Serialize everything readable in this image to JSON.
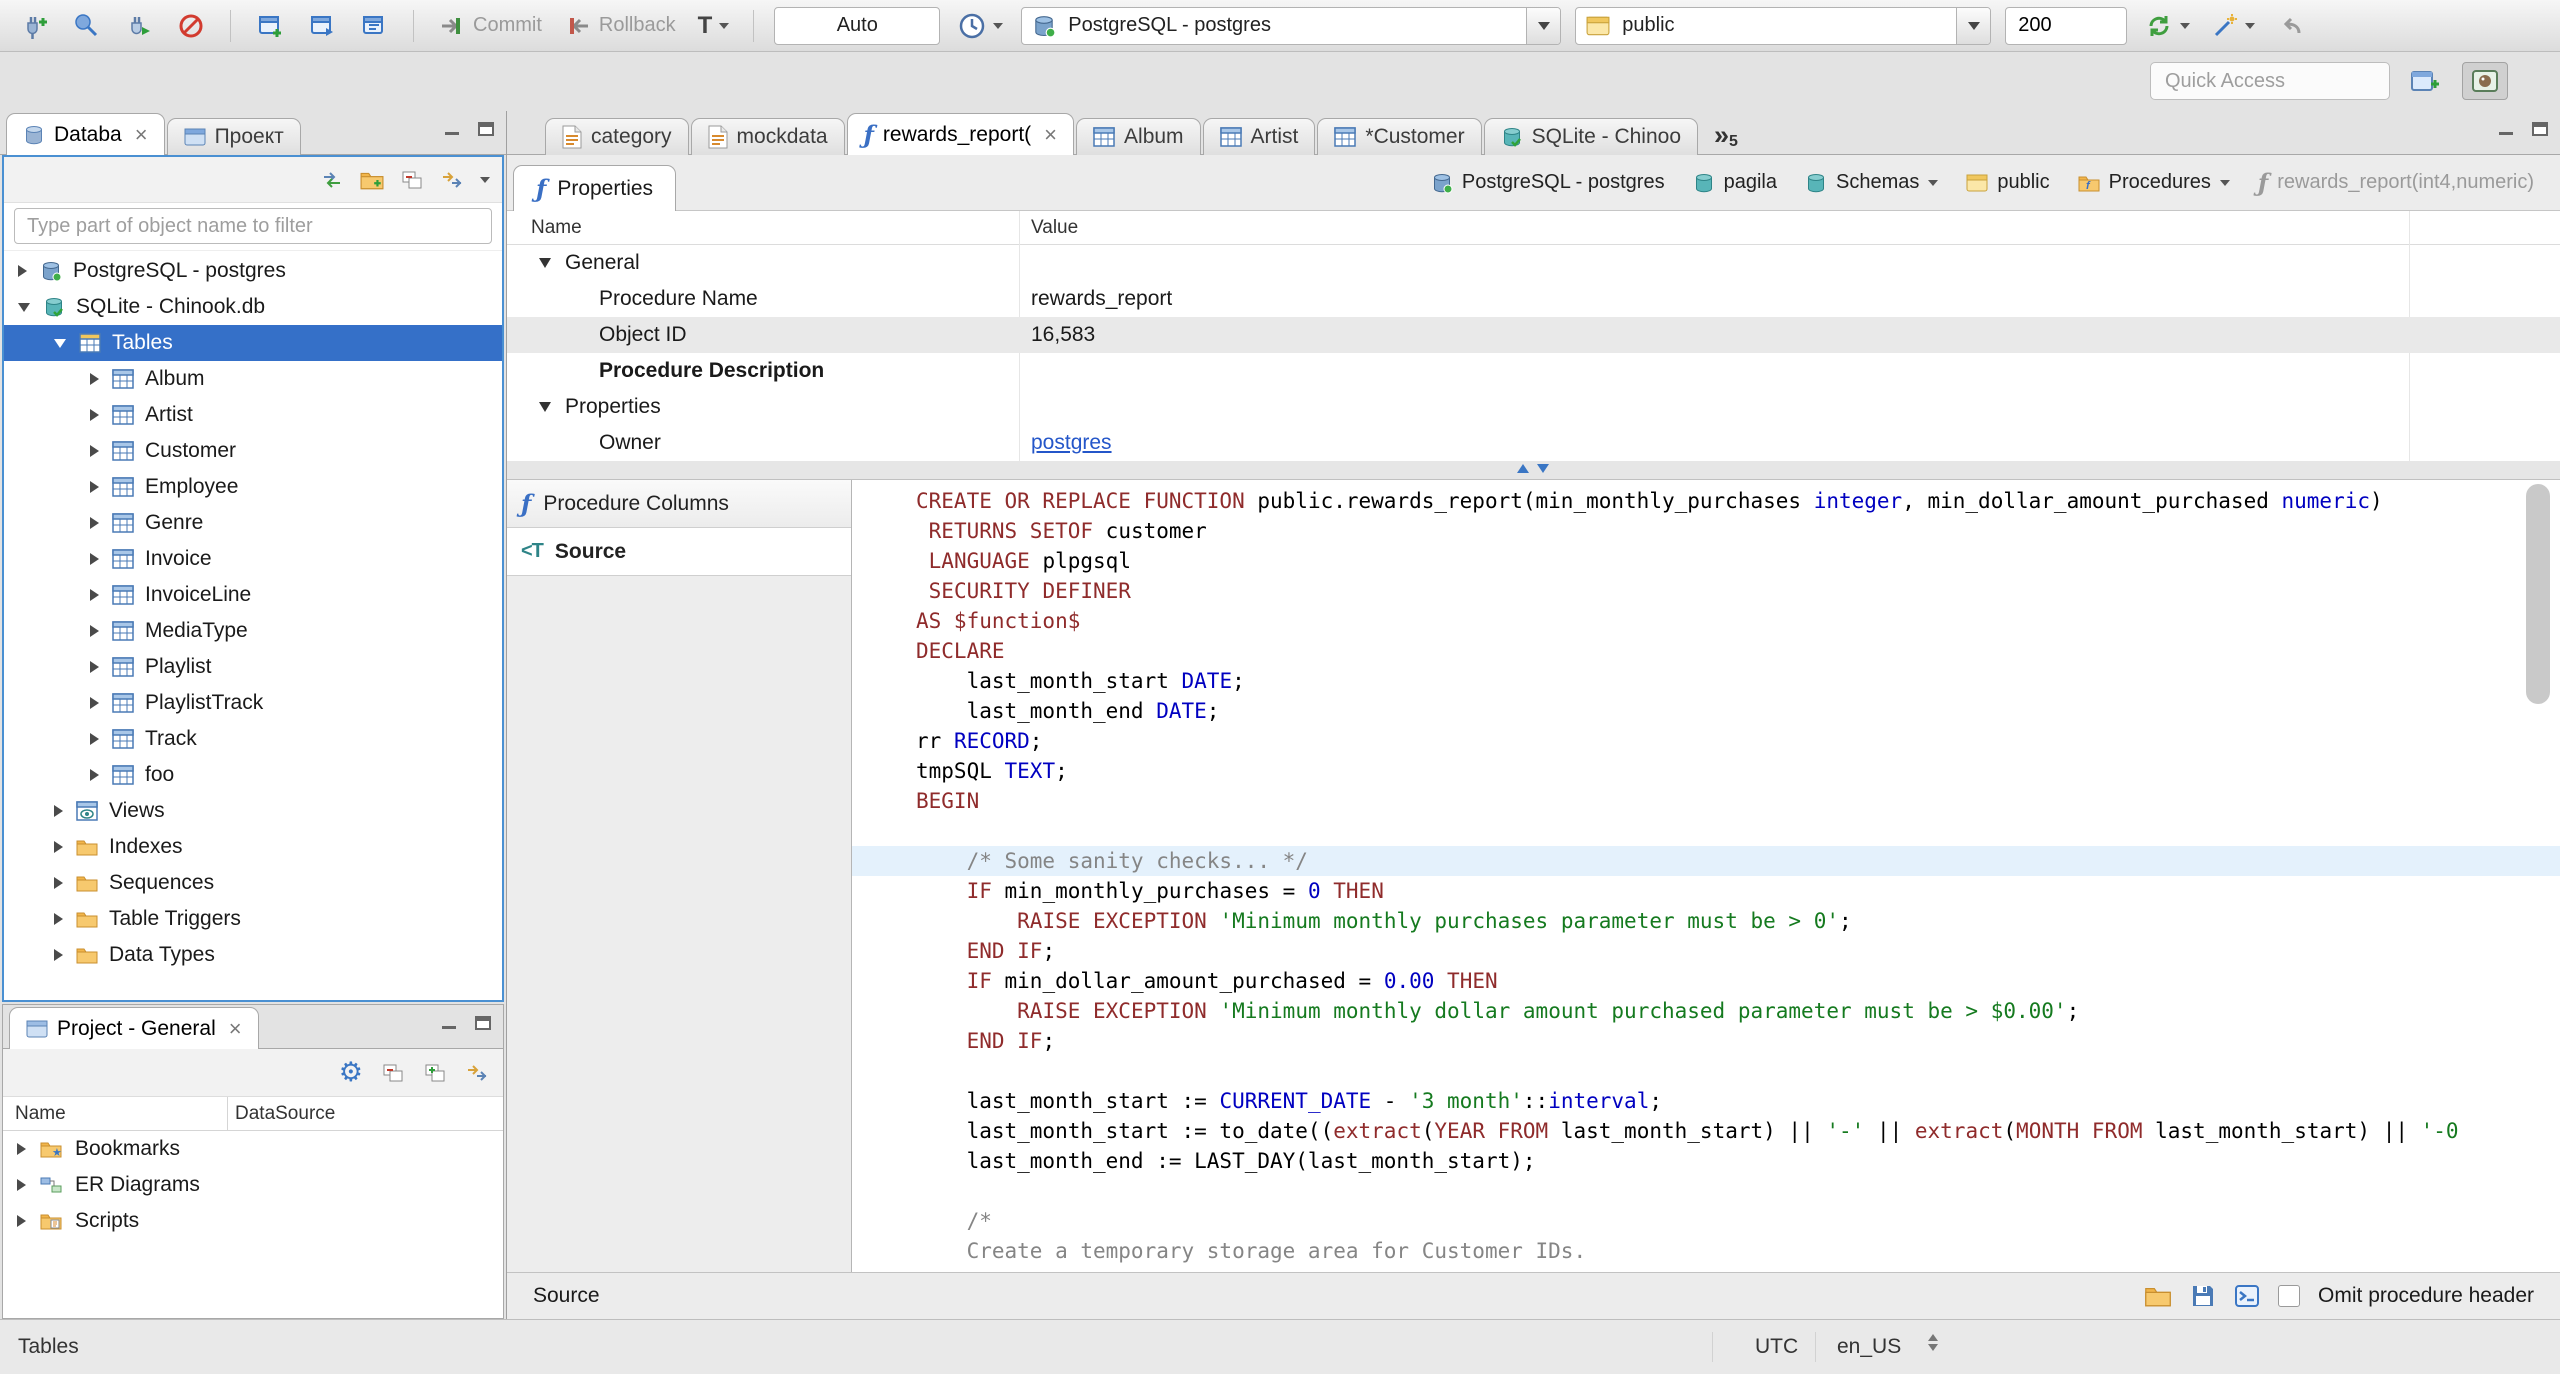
{
  "toolbar": {
    "commit_label": "Commit",
    "rollback_label": "Rollback",
    "txn_mode_label": "T",
    "auto_value": "Auto",
    "connection_value": "PostgreSQL - postgres",
    "database_value": "public",
    "fetch_size_value": "200",
    "quick_access_placeholder": "Quick Access"
  },
  "sidebar": {
    "tabs": [
      {
        "label": "Databa",
        "active": true,
        "closable": true
      },
      {
        "label": "Проект"
      }
    ],
    "filter_placeholder": "Type part of object name to filter",
    "tree": [
      {
        "label": "PostgreSQL - postgres",
        "icon": "postgres-db",
        "depth": 0,
        "arrow": "collapsed"
      },
      {
        "label": "SQLite - Chinook.db",
        "icon": "sqlite-db",
        "depth": 0,
        "arrow": "expanded"
      },
      {
        "label": "Tables",
        "icon": "tables",
        "depth": 1,
        "arrow": "expanded",
        "selected": true
      },
      {
        "label": "Album",
        "icon": "table",
        "depth": 2,
        "arrow": "collapsed"
      },
      {
        "label": "Artist",
        "icon": "table",
        "depth": 2,
        "arrow": "collapsed"
      },
      {
        "label": "Customer",
        "icon": "table",
        "depth": 2,
        "arrow": "collapsed"
      },
      {
        "label": "Employee",
        "icon": "table",
        "depth": 2,
        "arrow": "collapsed"
      },
      {
        "label": "Genre",
        "icon": "table",
        "depth": 2,
        "arrow": "collapsed"
      },
      {
        "label": "Invoice",
        "icon": "table",
        "depth": 2,
        "arrow": "collapsed"
      },
      {
        "label": "InvoiceLine",
        "icon": "table",
        "depth": 2,
        "arrow": "collapsed"
      },
      {
        "label": "MediaType",
        "icon": "table",
        "depth": 2,
        "arrow": "collapsed"
      },
      {
        "label": "Playlist",
        "icon": "table",
        "depth": 2,
        "arrow": "collapsed"
      },
      {
        "label": "PlaylistTrack",
        "icon": "table",
        "depth": 2,
        "arrow": "collapsed"
      },
      {
        "label": "Track",
        "icon": "table",
        "depth": 2,
        "arrow": "collapsed"
      },
      {
        "label": "foo",
        "icon": "table",
        "depth": 2,
        "arrow": "collapsed"
      },
      {
        "label": "Views",
        "icon": "views",
        "depth": 1,
        "arrow": "collapsed"
      },
      {
        "label": "Indexes",
        "icon": "folder",
        "depth": 1,
        "arrow": "collapsed"
      },
      {
        "label": "Sequences",
        "icon": "folder",
        "depth": 1,
        "arrow": "collapsed"
      },
      {
        "label": "Table Triggers",
        "icon": "folder",
        "depth": 1,
        "arrow": "collapsed"
      },
      {
        "label": "Data Types",
        "icon": "folder",
        "depth": 1,
        "arrow": "collapsed"
      }
    ]
  },
  "project_panel": {
    "tab_label": "Project - General",
    "columns": [
      "Name",
      "DataSource"
    ],
    "items": [
      {
        "label": "Bookmarks",
        "icon": "bookmarks-folder"
      },
      {
        "label": "ER Diagrams",
        "icon": "er-diagrams"
      },
      {
        "label": "Scripts",
        "icon": "scripts-folder"
      }
    ]
  },
  "editor": {
    "tabs": [
      {
        "label": "category",
        "icon": "sql-script"
      },
      {
        "label": "mockdata",
        "icon": "sql-script"
      },
      {
        "label": "rewards_report(",
        "icon": "function",
        "active": true,
        "closable": true
      },
      {
        "label": "Album",
        "icon": "table"
      },
      {
        "label": "Artist",
        "icon": "table"
      },
      {
        "label": "*Customer",
        "icon": "table"
      },
      {
        "label": "SQLite - Chinoo",
        "icon": "sqlite-db"
      }
    ],
    "tab_overflow_chevrons": "»",
    "tab_overflow_count": "5",
    "properties_tab_label": "Properties",
    "breadcrumb": [
      {
        "label": "PostgreSQL - postgres",
        "icon": "postgres-db"
      },
      {
        "label": "pagila",
        "icon": "db-teal"
      },
      {
        "label": "Schemas",
        "icon": "db-teal",
        "dropdown": true
      },
      {
        "label": "public",
        "icon": "schema-public"
      },
      {
        "label": "Procedures",
        "icon": "procedures",
        "dropdown": true
      },
      {
        "label": "rewards_report(int4,numeric)",
        "icon": "function-gray",
        "muted": true
      }
    ],
    "grid": {
      "columns": [
        "Name",
        "Value"
      ],
      "rows": [
        {
          "name": "General",
          "type": "group"
        },
        {
          "name": "Procedure Name",
          "value": "rewards_report"
        },
        {
          "name": "Object ID",
          "value": "16,583",
          "shaded": true
        },
        {
          "name": "Procedure Description",
          "bold": true
        },
        {
          "name": "Properties",
          "type": "group"
        },
        {
          "name": "Owner",
          "value": "postgres",
          "link": true
        }
      ]
    },
    "subnav": [
      {
        "label": "Procedure Columns",
        "icon": "function"
      },
      {
        "label": "Source",
        "icon": "source",
        "active": true
      }
    ],
    "source": {
      "highlight_line": 12,
      "lines": [
        [
          [
            "k",
            "CREATE OR REPLACE FUNCTION"
          ],
          [
            "d",
            " public.rewards_report(min_monthly_purchases "
          ],
          [
            "t",
            "integer"
          ],
          [
            "d",
            ", min_dollar_amount_purchased "
          ],
          [
            "t",
            "numeric"
          ],
          [
            "d",
            ")"
          ]
        ],
        [
          [
            "d",
            " "
          ],
          [
            "k",
            "RETURNS SETOF"
          ],
          [
            "d",
            " customer"
          ]
        ],
        [
          [
            "d",
            " "
          ],
          [
            "k",
            "LANGUAGE"
          ],
          [
            "d",
            " plpgsql"
          ]
        ],
        [
          [
            "d",
            " "
          ],
          [
            "k",
            "SECURITY DEFINER"
          ]
        ],
        [
          [
            "k",
            "AS $function$"
          ]
        ],
        [
          [
            "k",
            "DECLARE"
          ]
        ],
        [
          [
            "d",
            "    last_month_start "
          ],
          [
            "t",
            "DATE"
          ],
          [
            "d",
            ";"
          ]
        ],
        [
          [
            "d",
            "    last_month_end "
          ],
          [
            "t",
            "DATE"
          ],
          [
            "d",
            ";"
          ]
        ],
        [
          [
            "d",
            "rr "
          ],
          [
            "t",
            "RECORD"
          ],
          [
            "d",
            ";"
          ]
        ],
        [
          [
            "d",
            "tmpSQL "
          ],
          [
            "t",
            "TEXT"
          ],
          [
            "d",
            ";"
          ]
        ],
        [
          [
            "k",
            "BEGIN"
          ]
        ],
        [],
        [
          [
            "c",
            "    /* Some sanity checks... */"
          ]
        ],
        [
          [
            "d",
            "    "
          ],
          [
            "k",
            "IF"
          ],
          [
            "d",
            " min_monthly_purchases = "
          ],
          [
            "n",
            "0"
          ],
          [
            "d",
            " "
          ],
          [
            "k",
            "THEN"
          ]
        ],
        [
          [
            "d",
            "        "
          ],
          [
            "k",
            "RAISE EXCEPTION"
          ],
          [
            "d",
            " "
          ],
          [
            "s",
            "'Minimum monthly purchases parameter must be > 0'"
          ],
          [
            "d",
            ";"
          ]
        ],
        [
          [
            "d",
            "    "
          ],
          [
            "k",
            "END IF"
          ],
          [
            "d",
            ";"
          ]
        ],
        [
          [
            "d",
            "    "
          ],
          [
            "k",
            "IF"
          ],
          [
            "d",
            " min_dollar_amount_purchased = "
          ],
          [
            "n",
            "0.00"
          ],
          [
            "d",
            " "
          ],
          [
            "k",
            "THEN"
          ]
        ],
        [
          [
            "d",
            "        "
          ],
          [
            "k",
            "RAISE EXCEPTION"
          ],
          [
            "d",
            " "
          ],
          [
            "s",
            "'Minimum monthly dollar amount purchased parameter must be > $0.00'"
          ],
          [
            "d",
            ";"
          ]
        ],
        [
          [
            "d",
            "    "
          ],
          [
            "k",
            "END IF"
          ],
          [
            "d",
            ";"
          ]
        ],
        [],
        [
          [
            "d",
            "    last_month_start := "
          ],
          [
            "b",
            "CURRENT_DATE"
          ],
          [
            "d",
            " - "
          ],
          [
            "s",
            "'3 month'"
          ],
          [
            "d",
            "::"
          ],
          [
            "t",
            "interval"
          ],
          [
            "d",
            ";"
          ]
        ],
        [
          [
            "d",
            "    last_month_start := to_date(("
          ],
          [
            "k",
            "extract"
          ],
          [
            "d",
            "("
          ],
          [
            "k",
            "YEAR FROM"
          ],
          [
            "d",
            " last_month_start) || "
          ],
          [
            "s",
            "'-'"
          ],
          [
            "d",
            " || "
          ],
          [
            "k",
            "extract"
          ],
          [
            "d",
            "("
          ],
          [
            "k",
            "MONTH FROM"
          ],
          [
            "d",
            " last_month_start) || "
          ],
          [
            "s",
            "'-0"
          ]
        ],
        [
          [
            "d",
            "    last_month_end := LAST_DAY(last_month_start);"
          ]
        ],
        [],
        [
          [
            "c",
            "    /*"
          ]
        ],
        [
          [
            "c",
            "    Create a temporary storage area for Customer IDs."
          ]
        ],
        [
          [
            "c",
            "    */"
          ]
        ]
      ]
    },
    "bottom_bar": {
      "label": "Source",
      "checkbox_label": "Omit procedure header"
    }
  },
  "status_bar": {
    "left": "Tables",
    "timezone": "UTC",
    "locale": "en_US"
  }
}
